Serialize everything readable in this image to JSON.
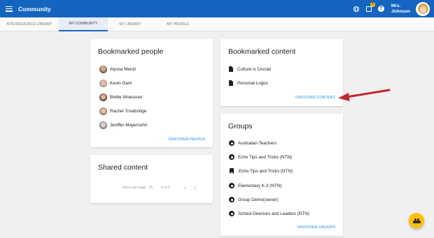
{
  "app": {
    "title": "Community"
  },
  "user": {
    "line1": "Mrs.",
    "line2": "Johnson",
    "notification_count": "3"
  },
  "icons": {
    "menu": "hamburger-icon",
    "globe": "globe-icon",
    "notifications": "clipboard-icon",
    "help": "help-icon",
    "fab": "group-add-icon"
  },
  "tabs": [
    {
      "label": "NTN RESOURCE LIBRARY",
      "active": false
    },
    {
      "label": "MY COMMUNITY",
      "active": true
    },
    {
      "label": "MY LIBRARY",
      "active": false
    },
    {
      "label": "MY PROFILE",
      "active": false
    }
  ],
  "bookmarked_people": {
    "title": "Bookmarked people",
    "people": [
      "Alyssa Mentz",
      "Kevin Gant",
      "Brette Woessner",
      "Rachel Trowbridge",
      "Jeniffer Mayersohn"
    ],
    "action": "DISCOVER PEOPLE"
  },
  "shared_content": {
    "title": "Shared content",
    "items_per_page_label": "Items per page:",
    "items_per_page_value": "25",
    "range": "0 of 0",
    "prev": "‹",
    "next": "›"
  },
  "bookmarked_content": {
    "title": "Bookmarked content",
    "items": [
      "Culture is Crucial",
      "Personal Logos"
    ],
    "action": "DISCOVER CONTENT"
  },
  "groups": {
    "title": "Groups",
    "items": [
      {
        "label": "Australian Teachers",
        "icon": "group-icon"
      },
      {
        "label": "Echo Tips and Tricks (NTN)",
        "icon": "group-icon"
      },
      {
        "label": "Echo Tips and Tricks (NTN)",
        "icon": "bookmark-icon"
      },
      {
        "label": "Elementary K-3 (NTN)",
        "icon": "group-icon"
      },
      {
        "label": "Group Demo(owner)",
        "icon": "group-icon"
      },
      {
        "label": "School Directors and Leaders (NTN)",
        "icon": "group-icon"
      }
    ],
    "action": "DISCOVER GROUPS"
  },
  "colors": {
    "appbar": "#1565c0",
    "link": "#1e88e5",
    "fab": "#ffc107",
    "arrow": "#c0272d"
  }
}
